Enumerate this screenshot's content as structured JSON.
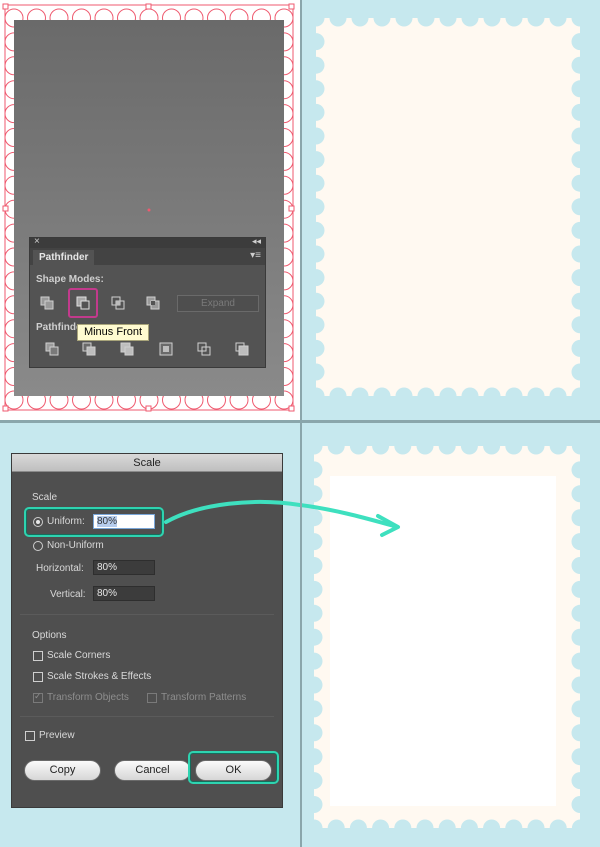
{
  "pathfinder": {
    "title": "Pathfinder",
    "shape_modes_label": "Shape Modes:",
    "pathfinders_label": "Pathfinders:",
    "expand_label": "Expand",
    "close_glyph": "×",
    "collapse_glyph": "◂◂",
    "menu_glyph": "▾≡",
    "shape_mode_icons": [
      "unite-icon",
      "minus-front-icon",
      "intersect-icon",
      "exclude-icon"
    ],
    "pathfinder_icons": [
      "divide-icon",
      "trim-icon",
      "merge-icon",
      "crop-icon",
      "outline-icon",
      "minus-back-icon"
    ]
  },
  "tooltip": {
    "text": "Minus Front"
  },
  "scale_dialog": {
    "title": "Scale",
    "scale_section": "Scale",
    "uniform_label": "Uniform:",
    "uniform_value": "80%",
    "non_uniform_label": "Non-Uniform",
    "horizontal_label": "Horizontal:",
    "horizontal_value": "80%",
    "vertical_label": "Vertical:",
    "vertical_value": "80%",
    "options_section": "Options",
    "scale_corners_label": "Scale Corners",
    "scale_strokes_label": "Scale Strokes & Effects",
    "transform_objects_label": "Transform Objects",
    "transform_patterns_label": "Transform Patterns",
    "preview_label": "Preview",
    "copy_label": "Copy",
    "cancel_label": "Cancel",
    "ok_label": "OK"
  },
  "colors": {
    "background": "#c6e8ee",
    "stamp": "#fff9f1",
    "selection": "#ef5a6f",
    "highlight_teal": "#2ed3b0",
    "highlight_magenta": "#c23a8c"
  }
}
